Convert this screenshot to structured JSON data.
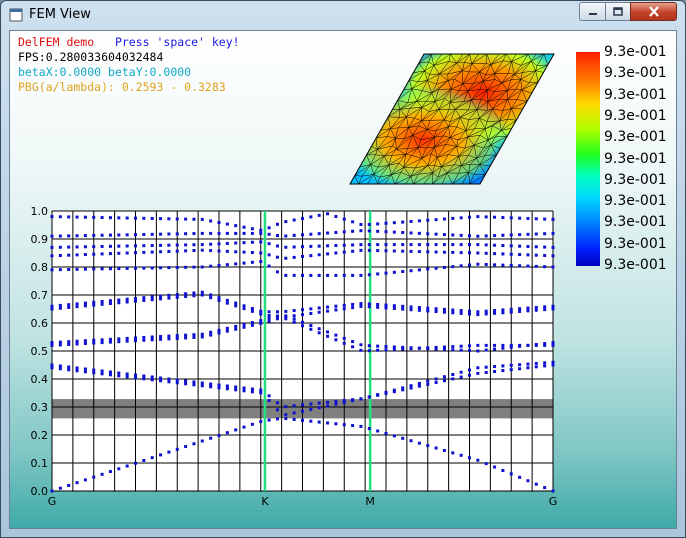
{
  "window": {
    "title": "FEM View",
    "buttons": {
      "minimize": "minimize-icon",
      "maximize": "maximize-icon",
      "close": "close-icon"
    }
  },
  "hud": {
    "app_name": "DelFEM demo",
    "instruction": "Press 'space' key!",
    "fps": "FPS:0.280033604032484",
    "beta": "betaX:0.0000 betaY:0.0000",
    "pbg": "PBG(a/lambda): 0.2593 - 0.3283"
  },
  "colorbar": {
    "labels": [
      "9.3e-001",
      "9.3e-001",
      "9.3e-001",
      "9.3e-001",
      "9.3e-001",
      "9.3e-001",
      "9.3e-001",
      "9.3e-001",
      "9.3e-001",
      "9.3e-001",
      "9.3e-001"
    ],
    "colors": [
      "#ff2000",
      "#ff7a00",
      "#ffd000",
      "#d0ff00",
      "#60ff00",
      "#00ff40",
      "#00ffc0",
      "#00d0ff",
      "#0080ff",
      "#0030ff",
      "#0000c8"
    ]
  },
  "chart_data": {
    "type": "scatter",
    "title": "",
    "xlabel": "",
    "ylabel": "",
    "ylim": [
      0.0,
      1.0
    ],
    "yticks": [
      "0.0",
      "0.1",
      "0.2",
      "0.3",
      "0.4",
      "0.5",
      "0.6",
      "0.7",
      "0.8",
      "0.9",
      "1.0"
    ],
    "x_points": [
      "G",
      "K",
      "M",
      "G"
    ],
    "band_gap": [
      0.2593,
      0.3283
    ],
    "grid": true,
    "series": [
      {
        "values": [
          0.0,
          0.04,
          0.08,
          0.13,
          0.18,
          0.22,
          0.25,
          0.26,
          0.25,
          0.24,
          0.23,
          0.22,
          0.21,
          0.24,
          0.18,
          0.13,
          0.08,
          0.04,
          0.0
        ],
        "segments": [
          [
            0,
            0.0
          ],
          [
            0.42,
            0.25
          ],
          [
            0.46,
            0.26
          ],
          [
            0.62,
            0.23
          ],
          [
            0.85,
            0.11
          ],
          [
            1.0,
            0.0
          ]
        ]
      },
      {
        "segments": [
          [
            0,
            0.44
          ],
          [
            0.42,
            0.35
          ],
          [
            0.46,
            0.27
          ],
          [
            0.62,
            0.33
          ],
          [
            0.85,
            0.42
          ],
          [
            1.0,
            0.45
          ]
        ]
      },
      {
        "segments": [
          [
            0,
            0.45
          ],
          [
            0.42,
            0.36
          ],
          [
            0.46,
            0.3
          ],
          [
            0.62,
            0.33
          ],
          [
            0.85,
            0.44
          ],
          [
            1.0,
            0.46
          ]
        ]
      },
      {
        "segments": [
          [
            0,
            0.52
          ],
          [
            0.3,
            0.55
          ],
          [
            0.42,
            0.6
          ],
          [
            0.46,
            0.62
          ],
          [
            0.62,
            0.5
          ],
          [
            0.85,
            0.52
          ],
          [
            1.0,
            0.52
          ]
        ]
      },
      {
        "segments": [
          [
            0,
            0.53
          ],
          [
            0.3,
            0.56
          ],
          [
            0.42,
            0.61
          ],
          [
            0.46,
            0.63
          ],
          [
            0.62,
            0.52
          ],
          [
            0.85,
            0.5
          ],
          [
            1.0,
            0.53
          ]
        ]
      },
      {
        "segments": [
          [
            0,
            0.65
          ],
          [
            0.3,
            0.7
          ],
          [
            0.42,
            0.63
          ],
          [
            0.46,
            0.62
          ],
          [
            0.62,
            0.66
          ],
          [
            0.85,
            0.63
          ],
          [
            1.0,
            0.65
          ]
        ]
      },
      {
        "segments": [
          [
            0,
            0.66
          ],
          [
            0.3,
            0.71
          ],
          [
            0.42,
            0.64
          ],
          [
            0.46,
            0.64
          ],
          [
            0.62,
            0.67
          ],
          [
            0.85,
            0.64
          ],
          [
            1.0,
            0.66
          ]
        ]
      },
      {
        "segments": [
          [
            0,
            0.79
          ],
          [
            0.3,
            0.8
          ],
          [
            0.42,
            0.82
          ],
          [
            0.46,
            0.77
          ],
          [
            0.62,
            0.77
          ],
          [
            0.85,
            0.81
          ],
          [
            1.0,
            0.8
          ]
        ]
      },
      {
        "segments": [
          [
            0,
            0.84
          ],
          [
            0.3,
            0.86
          ],
          [
            0.42,
            0.85
          ],
          [
            0.46,
            0.83
          ],
          [
            0.62,
            0.86
          ],
          [
            0.85,
            0.85
          ],
          [
            1.0,
            0.84
          ]
        ]
      },
      {
        "segments": [
          [
            0,
            0.87
          ],
          [
            0.3,
            0.88
          ],
          [
            0.42,
            0.89
          ],
          [
            0.46,
            0.87
          ],
          [
            0.62,
            0.88
          ],
          [
            0.85,
            0.88
          ],
          [
            1.0,
            0.87
          ]
        ]
      },
      {
        "segments": [
          [
            0,
            0.91
          ],
          [
            0.3,
            0.92
          ],
          [
            0.42,
            0.92
          ],
          [
            0.46,
            0.91
          ],
          [
            0.62,
            0.93
          ],
          [
            0.85,
            0.91
          ],
          [
            1.0,
            0.92
          ]
        ]
      },
      {
        "segments": [
          [
            0,
            0.98
          ],
          [
            0.3,
            0.97
          ],
          [
            0.42,
            0.93
          ],
          [
            0.46,
            0.96
          ],
          [
            0.55,
            0.99
          ],
          [
            0.62,
            0.95
          ],
          [
            0.85,
            0.98
          ],
          [
            1.0,
            0.97
          ]
        ]
      }
    ]
  }
}
